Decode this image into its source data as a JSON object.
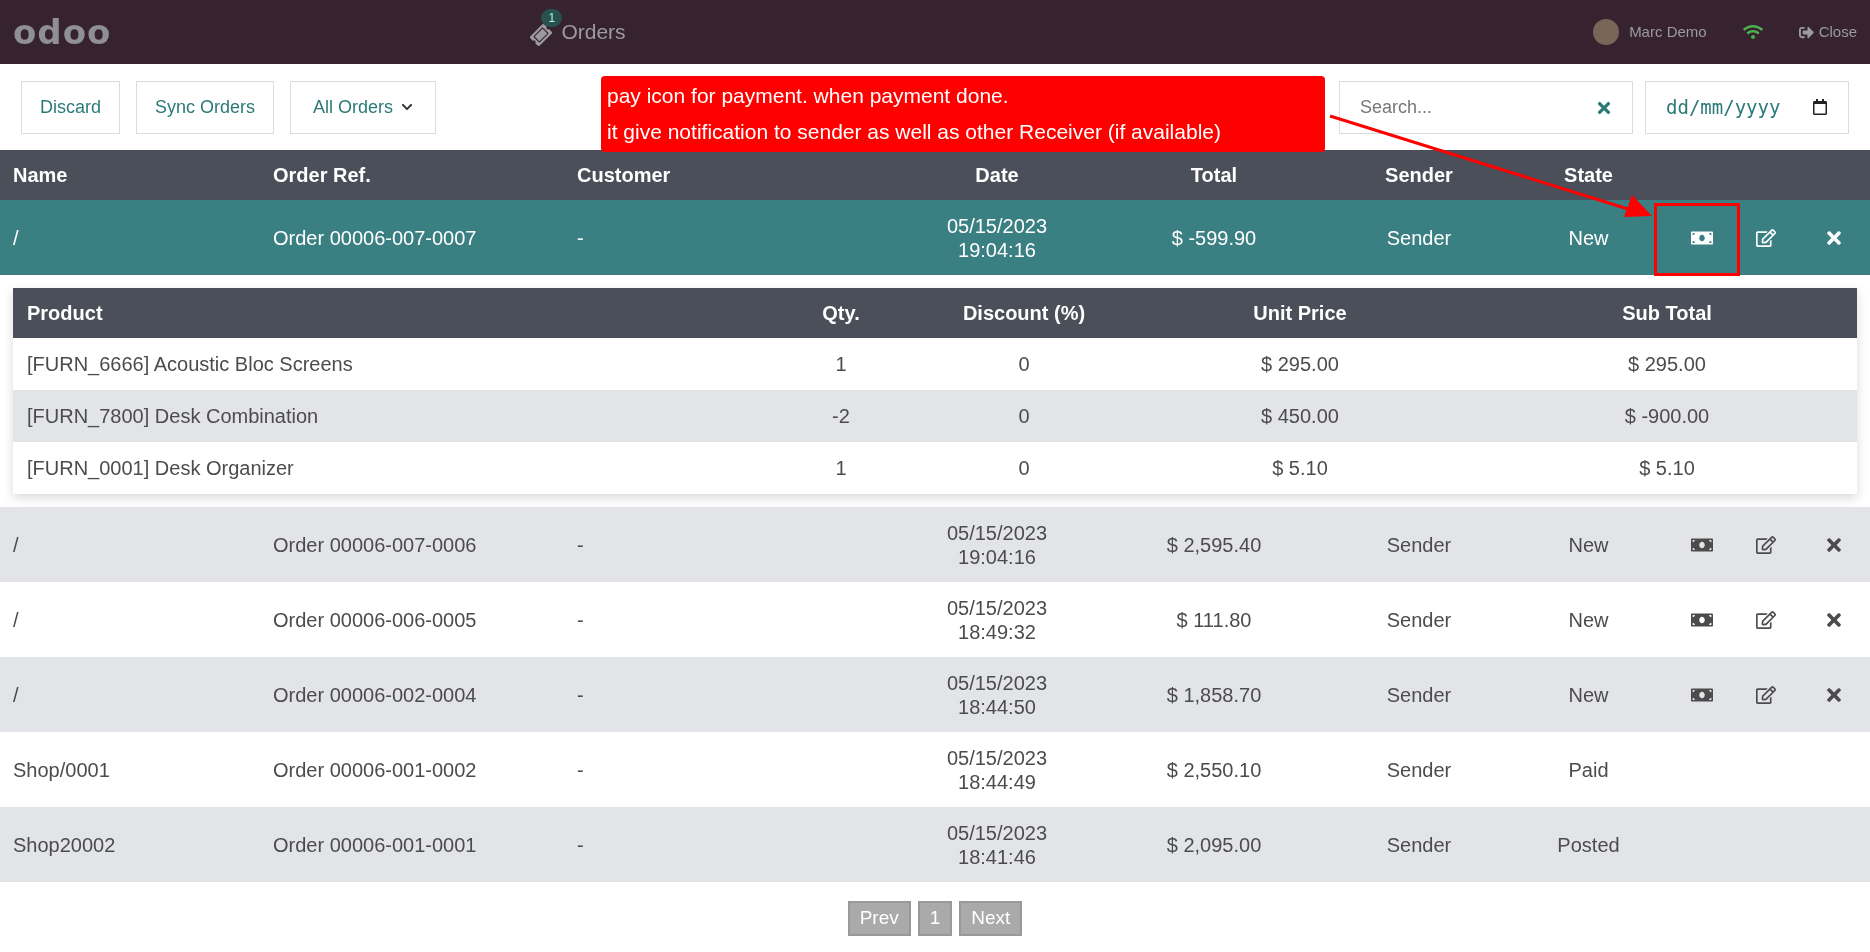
{
  "navbar": {
    "logo": "odoo",
    "menu_badge": "1",
    "title": "Orders",
    "user": "Marc Demo",
    "close": "Close"
  },
  "toolbar": {
    "buttons": [
      "Discard",
      "Sync Orders"
    ],
    "filter": "All Orders",
    "search": {
      "placeholder": "Search..."
    },
    "date": {
      "placeholder": "dd/mm/yyyy"
    }
  },
  "annotation": {
    "lines": [
      "pay icon for payment. when payment done.",
      "it give notification to sender as well as other Receiver (if available)"
    ]
  },
  "table": {
    "columns": [
      "Name",
      "Order Ref.",
      "Customer",
      "Date",
      "Total",
      "Sender",
      "State"
    ],
    "rows": [
      {
        "name": "/",
        "ref": "Order 00006-007-0007",
        "customer": "-",
        "date": "05/15/2023",
        "time": "19:04:16",
        "total": "$ -599.90",
        "sender": "Sender",
        "state": "New",
        "actions": true,
        "expanded": true,
        "annotated": true,
        "details": {
          "columns": [
            "Product",
            "Qty.",
            "Discount (%)",
            "Unit Price",
            "Sub Total"
          ],
          "lines": [
            [
              "[FURN_6666] Acoustic Bloc Screens",
              "1",
              "0",
              "$ 295.00",
              "$ 295.00"
            ],
            [
              "[FURN_7800] Desk Combination",
              "-2",
              "0",
              "$ 450.00",
              "$ -900.00"
            ],
            [
              "[FURN_0001] Desk Organizer",
              "1",
              "0",
              "$ 5.10",
              "$ 5.10"
            ]
          ]
        }
      },
      {
        "name": "/",
        "ref": "Order 00006-007-0006",
        "customer": "-",
        "date": "05/15/2023",
        "time": "19:04:16",
        "total": "$ 2,595.40",
        "sender": "Sender",
        "state": "New",
        "actions": true,
        "expanded": false,
        "annotated": false
      },
      {
        "name": "/",
        "ref": "Order 00006-006-0005",
        "customer": "-",
        "date": "05/15/2023",
        "time": "18:49:32",
        "total": "$ 111.80",
        "sender": "Sender",
        "state": "New",
        "actions": true,
        "expanded": false,
        "annotated": false
      },
      {
        "name": "/",
        "ref": "Order 00006-002-0004",
        "customer": "-",
        "date": "05/15/2023",
        "time": "18:44:50",
        "total": "$ 1,858.70",
        "sender": "Sender",
        "state": "New",
        "actions": true,
        "expanded": false,
        "annotated": false
      },
      {
        "name": "Shop/0001",
        "ref": "Order 00006-001-0002",
        "customer": "-",
        "date": "05/15/2023",
        "time": "18:44:49",
        "total": "$ 2,550.10",
        "sender": "Sender",
        "state": "Paid",
        "actions": false,
        "expanded": false,
        "annotated": false
      },
      {
        "name": "Shop20002",
        "ref": "Order 00006-001-0001",
        "customer": "-",
        "date": "05/15/2023",
        "time": "18:41:46",
        "total": "$ 2,095.00",
        "sender": "Sender",
        "state": "Posted",
        "actions": false,
        "expanded": false,
        "annotated": false
      }
    ]
  },
  "pagination": [
    "Prev",
    "1",
    "Next"
  ]
}
